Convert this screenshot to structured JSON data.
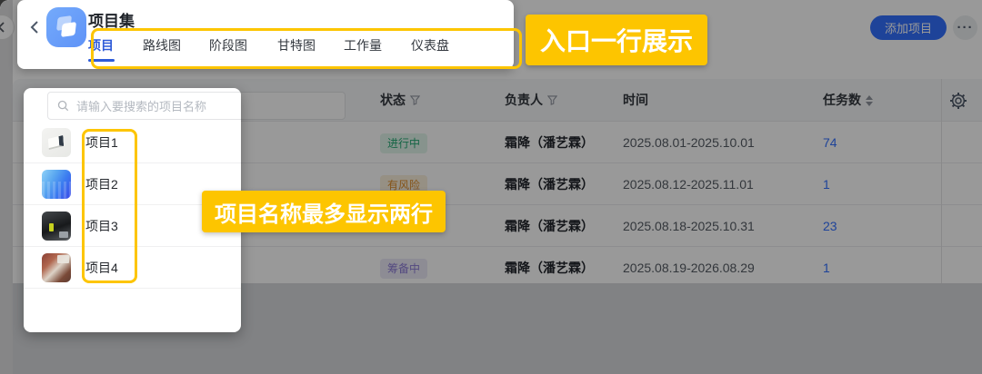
{
  "colors": {
    "accent_blue": "#3370ff",
    "annotation_yellow": "#fdc500",
    "status_green_text": "#23a873",
    "status_orange_text": "#de8c2a",
    "status_purple_text": "#8b7bd6"
  },
  "header": {
    "title": "项目集",
    "tabs": [
      {
        "label": "项目",
        "active": true
      },
      {
        "label": "路线图",
        "active": false
      },
      {
        "label": "阶段图",
        "active": false
      },
      {
        "label": "甘特图",
        "active": false
      },
      {
        "label": "工作量",
        "active": false
      },
      {
        "label": "仪表盘",
        "active": false
      }
    ],
    "add_button": "添加项目",
    "more_button": "···"
  },
  "annotations": {
    "tabs_note": "入口一行展示",
    "names_note": "项目名称最多显示两行"
  },
  "search": {
    "placeholder": "请输入要搜索的项目名称"
  },
  "table": {
    "columns": [
      {
        "label": "状态",
        "icon": "filter"
      },
      {
        "label": "负责人",
        "icon": "filter"
      },
      {
        "label": "时间"
      },
      {
        "label": "任务数",
        "icon": "sort"
      }
    ],
    "rows": [
      {
        "name": "项目1",
        "status": "进行中",
        "status_type": "green",
        "owner": "霜降（潘艺霖）",
        "time": "2025.08.01-2025.10.01",
        "tasks": "74"
      },
      {
        "name": "项目2",
        "status": "有风险",
        "status_type": "orange",
        "owner": "霜降（潘艺霖）",
        "time": "2025.08.12-2025.11.01",
        "tasks": "1"
      },
      {
        "name": "项目3",
        "status": null,
        "status_type": null,
        "owner": "霜降（潘艺霖）",
        "time": "2025.08.18-2025.10.31",
        "tasks": "23"
      },
      {
        "name": "项目4",
        "status": "筹备中",
        "status_type": "purple",
        "owner": "霜降（潘艺霖）",
        "time": "2025.08.19-2026.08.29",
        "tasks": "1"
      }
    ]
  }
}
